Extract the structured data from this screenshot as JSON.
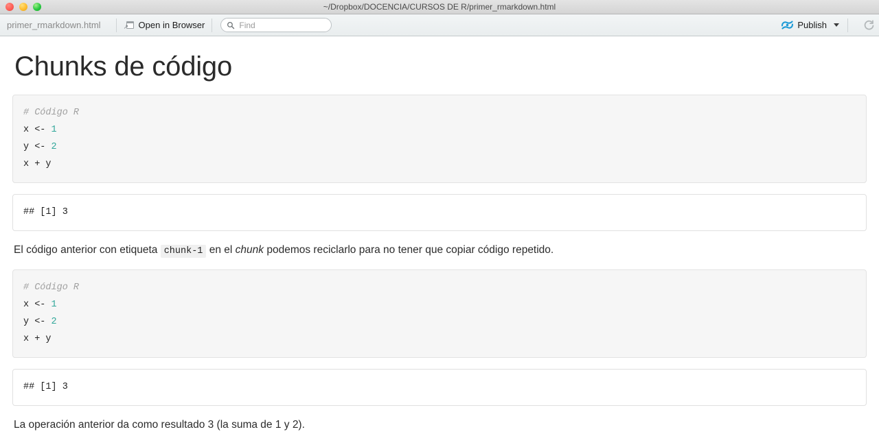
{
  "window": {
    "title": "~/Dropbox/DOCENCIA/CURSOS DE R/primer_rmarkdown.html",
    "close_label": "",
    "minimize_label": "",
    "zoom_label": ""
  },
  "toolbar": {
    "filename": "primer_rmarkdown.html",
    "open_in_browser_label": "Open in Browser",
    "open_in_browser_icon": "browser-window-icon",
    "find_placeholder": "Find",
    "find_value": "",
    "search_icon": "search-icon",
    "publish_label": "Publish",
    "publish_icon": "publish-icon",
    "publish_caret_icon": "chevron-down-icon",
    "refresh_icon": "refresh-icon",
    "accent_color": "#1e9ad6"
  },
  "document": {
    "heading": "Chunks de código",
    "blocks": [
      {
        "kind": "code",
        "comment": "# Código R",
        "lines": [
          {
            "text": "x <- ",
            "num": "1"
          },
          {
            "text": "y <- ",
            "num": "2"
          },
          {
            "text": "x + y",
            "num": ""
          }
        ]
      },
      {
        "kind": "output",
        "text": "## [1] 3"
      },
      {
        "kind": "paragraph",
        "before": "El código anterior con etiqueta ",
        "code": "chunk-1",
        "middle": " en el ",
        "emphasis": "chunk",
        "after": " podemos reciclarlo para no tener que copiar código repetido."
      },
      {
        "kind": "code",
        "comment": "# Código R",
        "lines": [
          {
            "text": "x <- ",
            "num": "1"
          },
          {
            "text": "y <- ",
            "num": "2"
          },
          {
            "text": "x + y",
            "num": ""
          }
        ]
      },
      {
        "kind": "output",
        "text": "## [1] 3"
      },
      {
        "kind": "paragraph_plain",
        "text": "La operación anterior da como resultado 3 (la suma de 1 y 2)."
      }
    ]
  },
  "colors": {
    "number_literal": "#2fa699",
    "comment": "#a0a0a0",
    "chunk_background": "#f6f6f6",
    "heading": "#2b2b2b"
  }
}
